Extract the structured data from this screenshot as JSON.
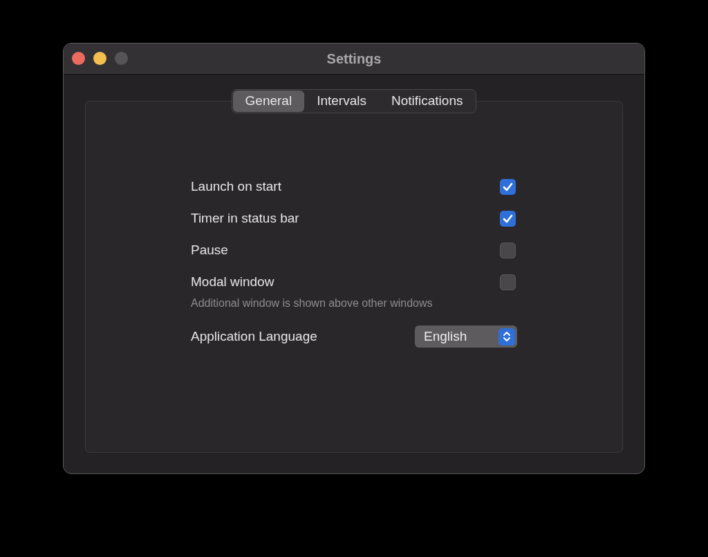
{
  "window": {
    "title": "Settings",
    "controls": [
      {
        "kind": "close",
        "enabled": true
      },
      {
        "kind": "minimize",
        "enabled": true
      },
      {
        "kind": "zoom",
        "enabled": false
      }
    ]
  },
  "tabs": [
    {
      "label": "General",
      "selected": true
    },
    {
      "label": "Intervals",
      "selected": false
    },
    {
      "label": "Notifications",
      "selected": false
    }
  ],
  "settings": [
    {
      "kind": "checkbox",
      "label": "Launch on start",
      "checked": true
    },
    {
      "kind": "checkbox",
      "label": "Timer in status bar",
      "checked": true
    },
    {
      "kind": "checkbox",
      "label": "Pause",
      "checked": false
    },
    {
      "kind": "checkbox",
      "label": "Modal window",
      "checked": false,
      "description": "Additional window is shown above other windows"
    },
    {
      "kind": "select",
      "label": "Application Language",
      "value": "English"
    }
  ]
}
